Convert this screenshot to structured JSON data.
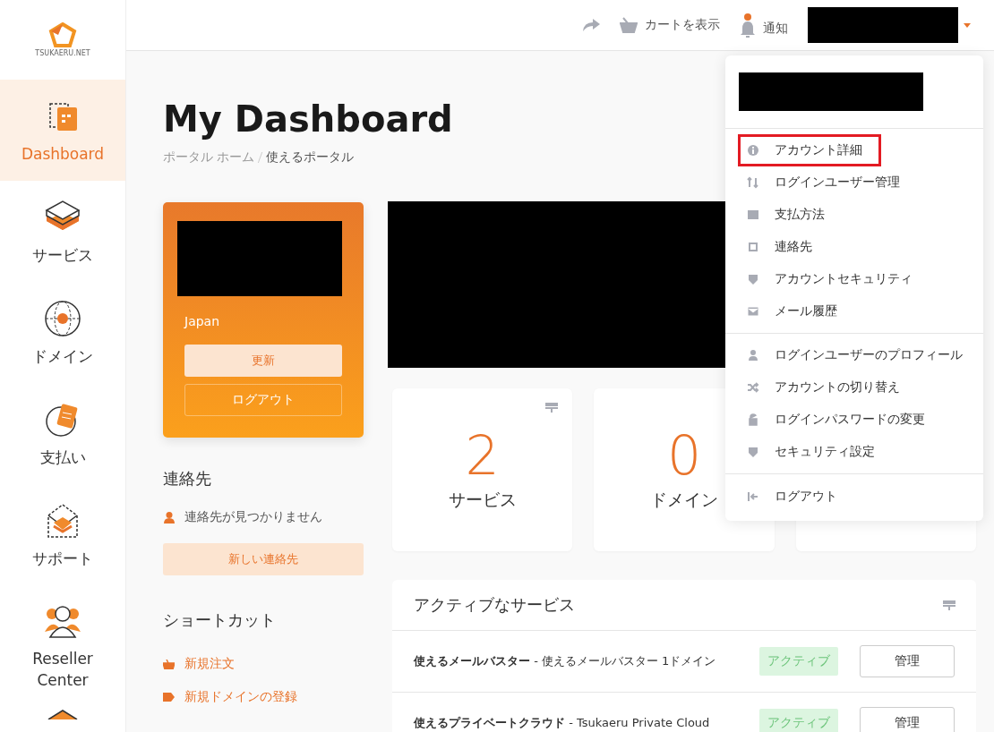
{
  "sidebar": {
    "logo": "TSUKAERU.NET",
    "items": [
      {
        "label": "Dashboard",
        "selected": true
      },
      {
        "label": "サービス",
        "selected": false
      },
      {
        "label": "ドメイン",
        "selected": false
      },
      {
        "label": "支払い",
        "selected": false
      },
      {
        "label": "サポート",
        "selected": false
      },
      {
        "label": "Reseller Center",
        "selected": false
      }
    ]
  },
  "header": {
    "cart": "カートを表示",
    "notifications": "通知",
    "notification_dot": true
  },
  "page": {
    "title": "My Dashboard",
    "breadcrumb": [
      "ポータル ホーム",
      "使えるポータル"
    ]
  },
  "profile_card": {
    "country": "Japan",
    "buttons": [
      "更新",
      "ログアウト"
    ]
  },
  "contacts": {
    "heading": "連絡先",
    "empty": "連絡先が見つかりません",
    "button": "新しい連絡先"
  },
  "shortcuts": {
    "heading": "ショートカット",
    "links": [
      "新規注文",
      "新規ドメインの登録"
    ]
  },
  "stats": [
    {
      "value": "2",
      "label": "サービス"
    },
    {
      "value": "0",
      "label": "ドメイン"
    }
  ],
  "active_services": {
    "title": "アクティブなサービス",
    "rows": [
      {
        "name": "使えるメールバスター",
        "description": "- 使えるメールバスター 1ドメイン",
        "status": "アクティブ",
        "button": "管理"
      },
      {
        "name": "使えるプライベートクラウド",
        "description": "- Tsukaeru Private Cloud",
        "status": "アクティブ",
        "button": "管理"
      }
    ]
  },
  "account_menu": {
    "groups": [
      [
        {
          "label": "アカウント詳細",
          "highlighted": true
        },
        {
          "label": "ログインユーザー管理",
          "highlighted": false
        },
        {
          "label": "支払方法",
          "highlighted": false
        },
        {
          "label": "連絡先",
          "highlighted": false
        },
        {
          "label": "アカウントセキュリティ",
          "highlighted": false
        },
        {
          "label": "メール履歴",
          "highlighted": false
        }
      ],
      [
        {
          "label": "ログインユーザーのプロフィール",
          "highlighted": false
        },
        {
          "label": "アカウントの切り替え",
          "highlighted": false
        },
        {
          "label": "ログインパスワードの変更",
          "highlighted": false
        },
        {
          "label": "セキュリティ設定",
          "highlighted": false
        }
      ],
      [
        {
          "label": "ログアウト",
          "highlighted": false
        }
      ]
    ]
  }
}
